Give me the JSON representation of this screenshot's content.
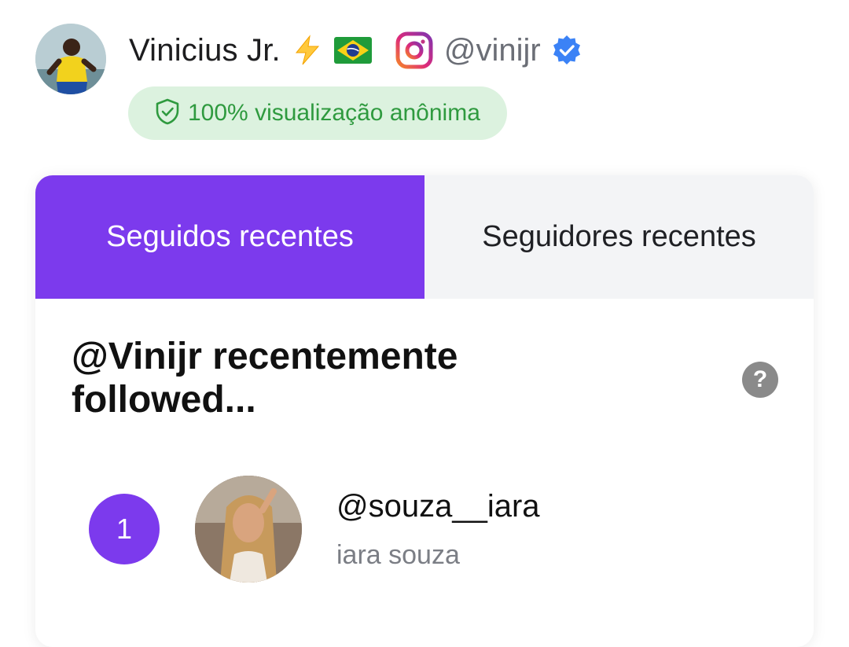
{
  "profile": {
    "name": "Vinicius Jr.",
    "handle": "@vinijr",
    "anon_badge": "100% visualização anônima",
    "icons": [
      "lightning-emoji",
      "brazil-flag",
      "instagram-icon",
      "verified-badge-icon",
      "shield-check-icon"
    ]
  },
  "tabs": [
    {
      "label": "Seguidos recentes",
      "active": true
    },
    {
      "label": "Seguidores recentes",
      "active": false
    }
  ],
  "section": {
    "title": "@Vinijr recentemente followed...",
    "help_label": "?"
  },
  "list": [
    {
      "rank": "1",
      "handle": "@souza__iara",
      "name": "iara souza"
    }
  ],
  "colors": {
    "accent": "#7c3aed",
    "badge_bg": "#dcf2df",
    "badge_text": "#2f9a3f",
    "verified": "#3b82f6"
  }
}
